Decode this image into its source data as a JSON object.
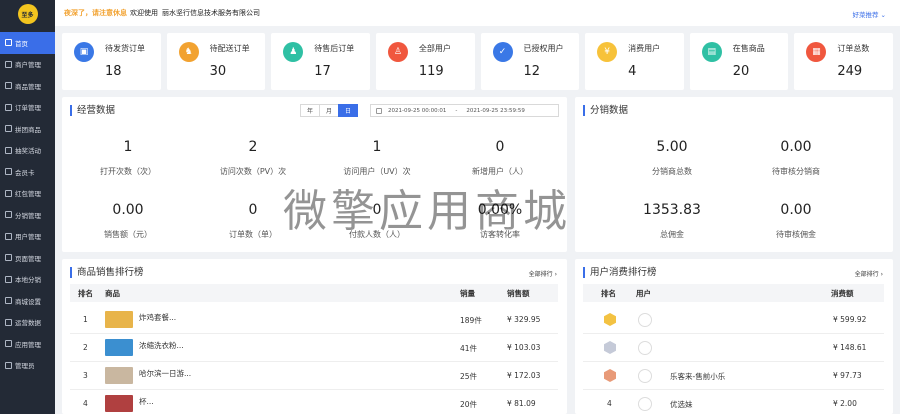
{
  "sidebar": {
    "logo_text": "至多",
    "items": [
      {
        "label": "首页",
        "active": true
      },
      {
        "label": "商户管理"
      },
      {
        "label": "商品管理"
      },
      {
        "label": "订单管理"
      },
      {
        "label": "拼团商品"
      },
      {
        "label": "抽奖活动"
      },
      {
        "label": "会员卡"
      },
      {
        "label": "红包管理"
      },
      {
        "label": "分销管理"
      },
      {
        "label": "用户管理"
      },
      {
        "label": "页面管理"
      },
      {
        "label": "本地分销"
      },
      {
        "label": "商城设置"
      },
      {
        "label": "运营数据"
      },
      {
        "label": "应用管理"
      },
      {
        "label": "管理员"
      }
    ]
  },
  "header": {
    "greeting": "夜深了，请注意休息",
    "welcome": "欢迎使用",
    "company": "丽水坚行信息技术服务有限公司",
    "recommend": "好菜推荐"
  },
  "stats": [
    {
      "label": "待发货订单",
      "value": "18",
      "color": "#3a78e6",
      "icon": "box-icon",
      "glyph": "▣"
    },
    {
      "label": "待配送订单",
      "value": "30",
      "color": "#f2a230",
      "icon": "scooter-icon",
      "glyph": "♞"
    },
    {
      "label": "待售后订单",
      "value": "17",
      "color": "#2fc0a4",
      "icon": "service-icon",
      "glyph": "♟"
    },
    {
      "label": "全部用户",
      "value": "119",
      "color": "#f0573e",
      "icon": "user-icon",
      "glyph": "♙"
    },
    {
      "label": "已授权用户",
      "value": "12",
      "color": "#3a78e6",
      "icon": "auth-user-icon",
      "glyph": "✓"
    },
    {
      "label": "消费用户",
      "value": "4",
      "color": "#f7c23a",
      "icon": "coin-icon",
      "glyph": "¥"
    },
    {
      "label": "在售商品",
      "value": "20",
      "color": "#2fc0a4",
      "icon": "shop-icon",
      "glyph": "▤"
    },
    {
      "label": "订单总数",
      "value": "249",
      "color": "#f0573e",
      "icon": "order-icon",
      "glyph": "▦"
    }
  ],
  "business": {
    "title": "经营数据",
    "periods": [
      "年",
      "月",
      "日"
    ],
    "active_period": "日",
    "date_start": "2021-09-25 00:00:01",
    "date_sep": "-",
    "date_end": "2021-09-25 23:59:59",
    "metrics": [
      {
        "value": "1",
        "label": "打开次数（次）"
      },
      {
        "value": "2",
        "label": "访问次数（PV）次"
      },
      {
        "value": "1",
        "label": "访问用户（UV）次"
      },
      {
        "value": "0",
        "label": "新增用户（人）"
      },
      {
        "value": "0.00",
        "label": "销售额（元）"
      },
      {
        "value": "0",
        "label": "订单数（单）"
      },
      {
        "value": "0",
        "label": "付款人数（人）"
      },
      {
        "value": "0.00%",
        "label": "访客转化率"
      }
    ]
  },
  "distribution": {
    "title": "分销数据",
    "metrics": [
      {
        "value": "5.00",
        "label": "分销商总数"
      },
      {
        "value": "0.00",
        "label": "待审核分销商"
      },
      {
        "value": "1353.83",
        "label": "总佣金"
      },
      {
        "value": "0.00",
        "label": "待审核佣金"
      }
    ]
  },
  "product_rank": {
    "title": "商品销售排行榜",
    "more": "全部排行",
    "headers": {
      "rank": "排名",
      "product": "商品",
      "qty": "销量",
      "amount": "销售额"
    },
    "rows": [
      {
        "rank": "1",
        "name": "炸鸡套餐...",
        "qty": "189件",
        "amount": "¥ 329.95",
        "thumb": "#e8b44a"
      },
      {
        "rank": "2",
        "name": "浓缩洗衣粉...",
        "qty": "41件",
        "amount": "¥ 103.03",
        "thumb": "#3b8fd0"
      },
      {
        "rank": "3",
        "name": "哈尔滨一日游...",
        "qty": "25件",
        "amount": "¥ 172.03",
        "thumb": "#c9b7a0"
      },
      {
        "rank": "4",
        "name": "杯...",
        "qty": "20件",
        "amount": "¥ 81.09",
        "thumb": "#b04040"
      }
    ]
  },
  "user_rank": {
    "title": "用户消费排行榜",
    "more": "全部排行",
    "headers": {
      "rank": "排名",
      "user": "用户",
      "amount": "消费额"
    },
    "rows": [
      {
        "rank": "1",
        "medal": "#f3c242",
        "name": "",
        "amount": "¥ 599.92"
      },
      {
        "rank": "2",
        "medal": "#c5cad8",
        "name": "",
        "amount": "¥ 148.61"
      },
      {
        "rank": "3",
        "medal": "#e89a78",
        "name": "乐客来-售前小乐",
        "amount": "¥ 97.73"
      },
      {
        "rank": "4",
        "medal": "",
        "name": "优选妹",
        "amount": "¥ 2.00"
      }
    ]
  },
  "watermark": "微擎应用商城"
}
